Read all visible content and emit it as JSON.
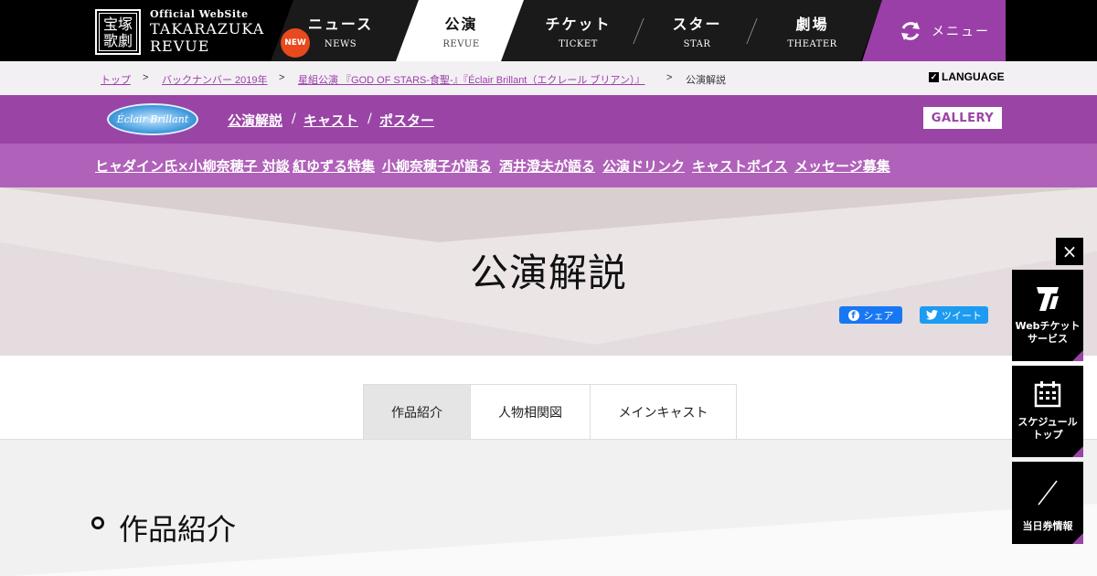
{
  "header": {
    "logo_mark": "宝塚歌劇",
    "logo_sub": "Official WebSite",
    "logo_main": "TAKARAZUKA REVUE",
    "new_badge": "NEW",
    "nav": [
      {
        "jp": "ニュース",
        "en": "NEWS"
      },
      {
        "jp": "公演",
        "en": "REVUE"
      },
      {
        "jp": "チケット",
        "en": "TICKET"
      },
      {
        "jp": "スター",
        "en": "STAR"
      },
      {
        "jp": "劇場",
        "en": "THEATER"
      }
    ],
    "menu_label": "メニュー",
    "brand_color": "#9b3fa8"
  },
  "breadcrumb": {
    "items": [
      "トップ",
      "バックナンバー 2019年",
      "星組公演 『GOD OF STARS-食聖-』『Éclair Brillant（エクレール ブリアン）』",
      "公演解説"
    ],
    "separator": ">",
    "language": "LANGUAGE"
  },
  "subnav": {
    "show_logo": "Éclair Brillant",
    "links": [
      "公演解説",
      "キャスト",
      "ポスター"
    ],
    "slash": "/",
    "gallery": "GALLERY"
  },
  "features": [
    "ヒャダイン氏×小柳奈穂子 対談",
    "紅ゆずる特集",
    "小柳奈穂子が語る",
    "酒井澄夫が語る",
    "公演ドリンク",
    "キャストボイス",
    "メッセージ募集"
  ],
  "hero": {
    "title": "公演解説",
    "share_fb": "シェア",
    "share_tw": "ツイート"
  },
  "tabs": {
    "items": [
      "作品紹介",
      "人物相関図",
      "メインキャスト"
    ],
    "active": "作品紹介"
  },
  "section": {
    "title": "作品紹介"
  },
  "side": {
    "close": "×",
    "widgets": [
      {
        "label1": "Webチケット",
        "label2": "サービス",
        "icon": "ticket-logo-icon"
      },
      {
        "label1": "スケジュール",
        "label2": "トップ",
        "icon": "calendar-icon"
      },
      {
        "label1": "当日券情報",
        "label2": "",
        "icon": "slash-icon"
      }
    ]
  }
}
